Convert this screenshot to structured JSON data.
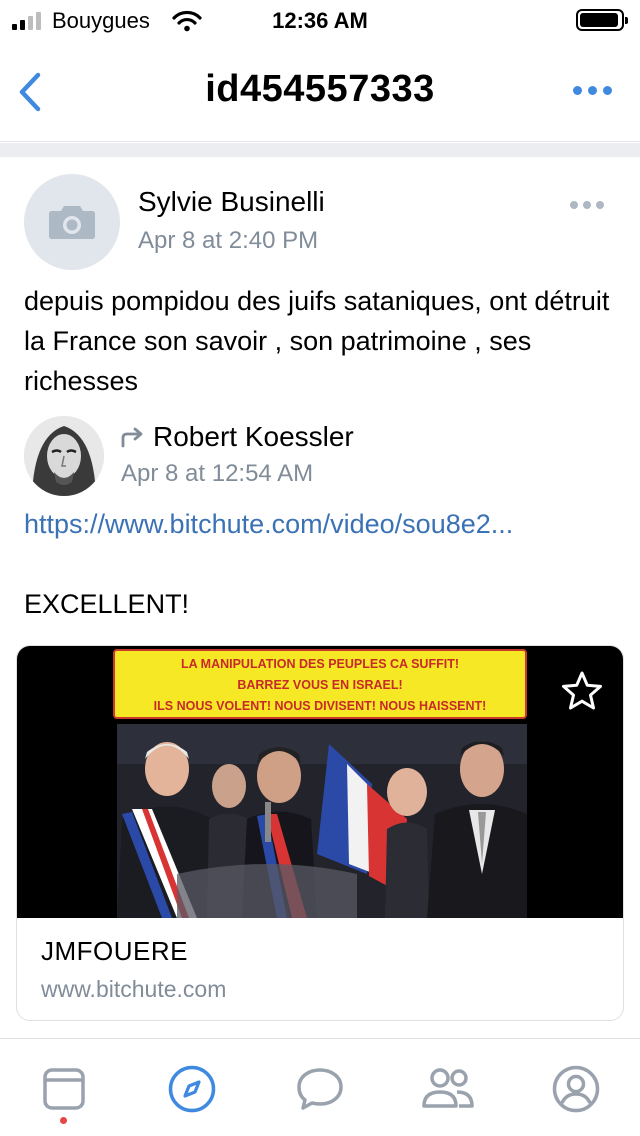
{
  "status_bar": {
    "carrier": "Bouygues",
    "time": "12:36 AM",
    "battery_level": 0.85
  },
  "nav": {
    "title": "id454557333",
    "icons": {
      "back": "chevron-left-icon",
      "more": "more-horizontal-icon"
    }
  },
  "post": {
    "author": "Sylvie Businelli",
    "date": "Apr 8 at 2:40 PM",
    "text": "depuis pompidou des juifs sataniques, ont détruit la France son savoir , son patrimoine , ses richesses",
    "repost": {
      "author": "Robert Koessler",
      "date": "Apr 8 at 12:54 AM",
      "link": "https://www.bitchute.com/video/sou8e2...",
      "text": "EXCELLENT!"
    },
    "attachment": {
      "banner_lines": [
        "LA MANIPULATION DES PEUPLES CA SUFFIT!",
        "BARREZ VOUS EN ISRAEL!",
        "ILS NOUS VOLENT! NOUS DIVISENT! NOUS HAISSENT!"
      ],
      "title": "JMFOUERE",
      "domain": "www.bitchute.com"
    }
  },
  "tabbar": {
    "tabs": [
      "news-icon",
      "discover-icon",
      "messages-icon",
      "friends-icon",
      "profile-icon"
    ],
    "active": "discover-icon"
  },
  "colors": {
    "accent": "#3f8ae0",
    "secondary_text": "#818c99",
    "separator": "#ebedf0",
    "badge": "#e64646"
  }
}
